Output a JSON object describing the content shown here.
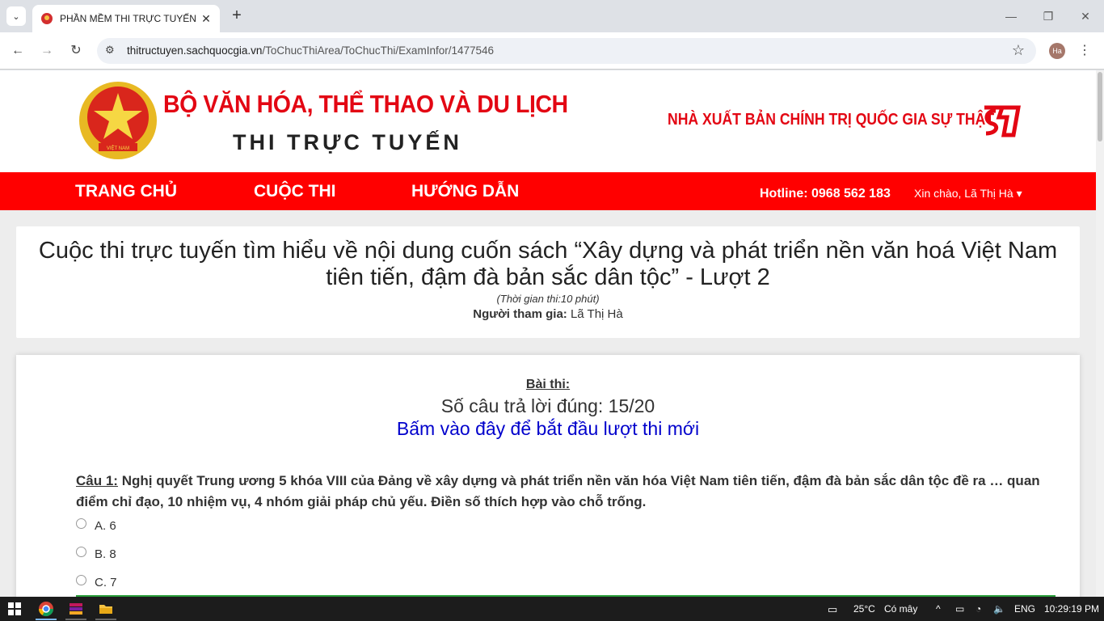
{
  "browser": {
    "tab_title": "PHẦN MỀM THI TRỰC TUYẾN -",
    "tab_close": "✕",
    "new_tab": "+",
    "url_host": "thitructuyen.sachquocgia.vn",
    "url_path": "/ToChucThiArea/ToChucThi/ExamInfor/1477546",
    "profile_initials": "Ha"
  },
  "header": {
    "ministry": "BỘ VĂN HÓA, THỂ THAO VÀ DU LỊCH",
    "subtitle": "THI TRỰC TUYẾN",
    "publisher": "NHÀ XUẤT BẢN CHÍNH TRỊ QUỐC GIA SỰ THẬT",
    "emblem_text": "VIỆT NAM"
  },
  "nav": {
    "home": "TRANG CHỦ",
    "contest": "CUỘC THI",
    "guide": "HƯỚNG DẪN",
    "hotline": "Hotline: 0968 562 183",
    "greeting": "Xin chào, Lã Thị Hà ▾"
  },
  "contest": {
    "title": "Cuộc thi trực tuyến tìm hiểu về nội dung cuốn sách “Xây dựng và phát triển nền văn hoá Việt Nam tiên tiến, đậm đà bản sắc dân tộc” - Lượt 2",
    "duration": "(Thời gian thi:10 phút)",
    "participant_label": "Người tham gia:",
    "participant_name": "Lã Thị Hà"
  },
  "exam": {
    "label": "Bài thi:",
    "score": "Số câu trả lời đúng: 15/20",
    "retry_link": "Bấm vào đây để bắt đầu lượt thi mới",
    "question_no": "Câu 1:",
    "question_text": "Nghị quyết Trung ương 5 khóa VIII của Đảng về xây dựng và phát triển nền văn hóa Việt Nam tiên tiến, đậm đà bản sắc dân tộc đề ra … quan điểm chỉ đạo, 10 nhiệm vụ, 4 nhóm giải pháp chủ yếu. Điền số thích hợp vào chỗ trống.",
    "options": [
      "A. 6",
      "B. 8",
      "C. 7"
    ]
  },
  "taskbar": {
    "temperature": "25°C",
    "weather": "Có mây",
    "language": "ENG",
    "time": "10:29:19 PM"
  },
  "colors": {
    "brand_red": "#ff0000",
    "link_blue": "#0000cc"
  }
}
